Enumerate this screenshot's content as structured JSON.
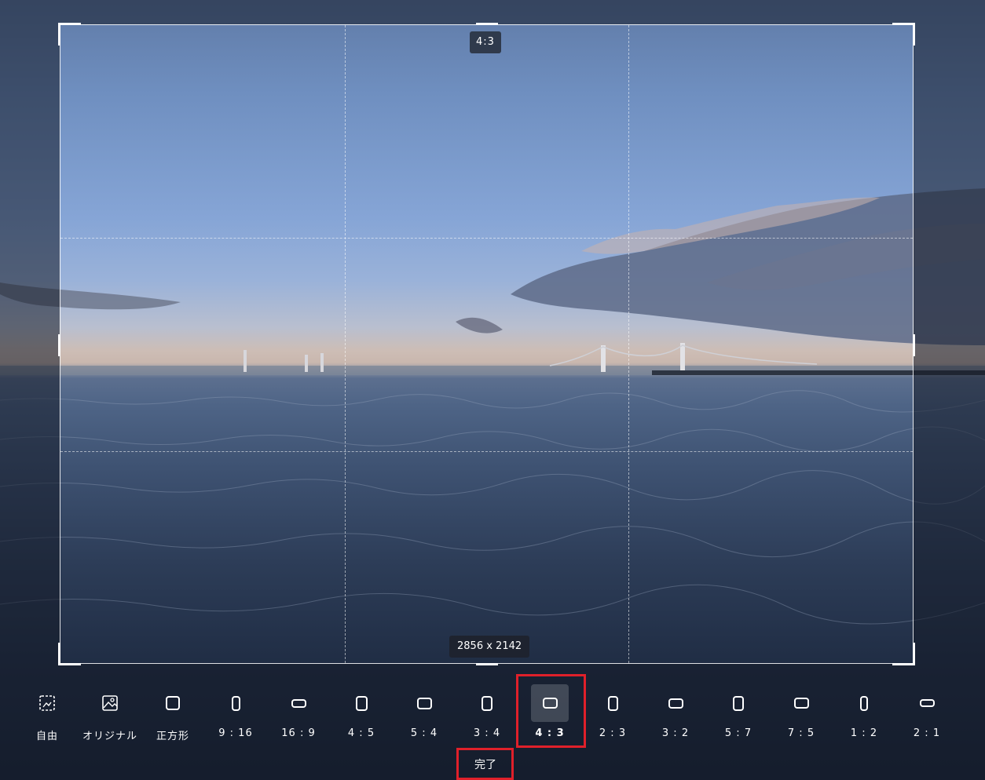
{
  "crop": {
    "ratio_badge": "4:3",
    "size_badge": "2856 x 2142"
  },
  "toolbar": {
    "items": [
      {
        "label": "自由",
        "icon": "freeform-crop-icon"
      },
      {
        "label": "オリジナル",
        "icon": "original-image-icon"
      },
      {
        "label": "正方形",
        "icon": "square-icon"
      },
      {
        "label": "9 : 16",
        "icon": "portrait-9-16-icon"
      },
      {
        "label": "16 : 9",
        "icon": "landscape-16-9-icon"
      },
      {
        "label": "4 : 5",
        "icon": "portrait-4-5-icon"
      },
      {
        "label": "5 : 4",
        "icon": "landscape-5-4-icon"
      },
      {
        "label": "3 : 4",
        "icon": "portrait-3-4-icon"
      },
      {
        "label": "4 : 3",
        "icon": "landscape-4-3-icon",
        "selected": true
      },
      {
        "label": "2 : 3",
        "icon": "portrait-2-3-icon"
      },
      {
        "label": "3 : 2",
        "icon": "landscape-3-2-icon"
      },
      {
        "label": "5 : 7",
        "icon": "portrait-5-7-icon"
      },
      {
        "label": "7 : 5",
        "icon": "landscape-7-5-icon"
      },
      {
        "label": "1 : 2",
        "icon": "portrait-1-2-icon"
      },
      {
        "label": "2 : 1",
        "icon": "landscape-2-1-icon"
      }
    ],
    "done_label": "完了"
  },
  "colors": {
    "highlight": "#e0202a",
    "frame": "#ffffff",
    "badge_bg": "#28303e"
  }
}
